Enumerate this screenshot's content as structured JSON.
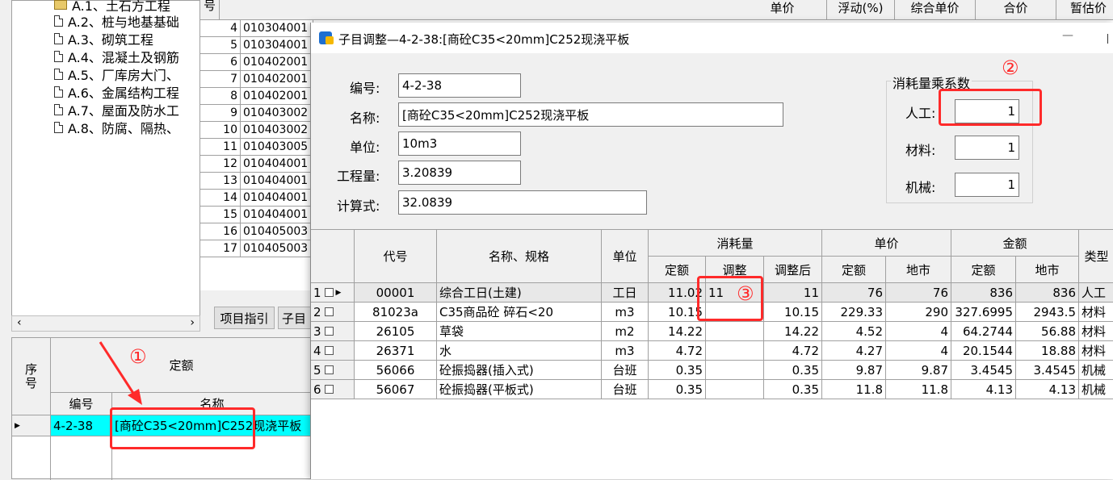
{
  "tree": {
    "items": [
      {
        "label": "A.1、土石方工程",
        "open": true
      },
      {
        "label": "A.2、桩与地基基础"
      },
      {
        "label": "A.3、砌筑工程"
      },
      {
        "label": "A.4、混凝土及钢筋"
      },
      {
        "label": "A.5、厂库房大门、"
      },
      {
        "label": "A.6、金属结构工程"
      },
      {
        "label": "A.7、屋面及防水工"
      },
      {
        "label": "A.8、防腐、隔热、"
      }
    ]
  },
  "bg_table": {
    "hdr_seq": "号",
    "headers": [
      "单价",
      "浮动(%)",
      "综合单价",
      "合价",
      "暂估价"
    ],
    "rows": [
      {
        "seq": "4",
        "code": "010304001"
      },
      {
        "seq": "5",
        "code": "010304001"
      },
      {
        "seq": "6",
        "code": "010402001"
      },
      {
        "seq": "7",
        "code": "010402001"
      },
      {
        "seq": "8",
        "code": "010402001"
      },
      {
        "seq": "9",
        "code": "010403002"
      },
      {
        "seq": "10",
        "code": "010403002"
      },
      {
        "seq": "11",
        "code": "010403005"
      },
      {
        "seq": "12",
        "code": "010404001"
      },
      {
        "seq": "13",
        "code": "010404001"
      },
      {
        "seq": "14",
        "code": "010404001"
      },
      {
        "seq": "15",
        "code": "010404001"
      },
      {
        "seq": "16",
        "code": "010405003"
      },
      {
        "seq": "17",
        "code": "010405003"
      }
    ],
    "tab_guide": "项目指引",
    "tab_sub": "子目"
  },
  "bottom": {
    "hdr_seq": "序号",
    "hdr_quota": "定额",
    "hdr_code": "编号",
    "hdr_name": "名称",
    "row": {
      "code": "4-2-38",
      "name": "[商砼C35<20mm]C252现浇平板"
    }
  },
  "dialog": {
    "title": "子目调整—4-2-38:[商砼C35<20mm]C252现浇平板",
    "minimize": "—",
    "fields": {
      "code_label": "编号:",
      "code_value": "4-2-38",
      "name_label": "名称:",
      "name_value": "[商砼C35<20mm]C252现浇平板",
      "unit_label": "单位:",
      "unit_value": "10m3",
      "qty_label": "工程量:",
      "qty_value": "3.20839",
      "formula_label": "计算式:",
      "formula_value": "32.0839"
    },
    "coef": {
      "title": "消耗量乘系数",
      "labor_label": "人工:",
      "labor_value": "1",
      "material_label": "材料:",
      "material_value": "1",
      "machine_label": "机械:",
      "machine_value": "1"
    },
    "grid": {
      "h_code": "代号",
      "h_name": "名称、规格",
      "h_unit": "单位",
      "h_consumption": "消耗量",
      "h_price": "单价",
      "h_amount": "金额",
      "h_type": "类型",
      "h_quota": "定额",
      "h_adjust": "调整",
      "h_adjusted": "调整后",
      "h_price_quota": "定额",
      "h_price_market": "地市",
      "h_amt_quota": "定额",
      "h_amt_market": "地市",
      "rows": [
        {
          "idx": "1",
          "code": "00001",
          "name": "综合工日(土建)",
          "unit": "工日",
          "quota": "11.02",
          "adjust": "11",
          "adjusted": "11",
          "p_quota": "76",
          "p_market": "76",
          "a_quota": "836",
          "a_market": "836",
          "type": "人工"
        },
        {
          "idx": "2",
          "code": "81023a",
          "name": "C35商品砼 碎石<20",
          "unit": "m3",
          "quota": "10.15",
          "adjust": "",
          "adjusted": "10.15",
          "p_quota": "229.33",
          "p_market": "290",
          "a_quota": "327.6995",
          "a_market": "2943.5",
          "type": "材料"
        },
        {
          "idx": "3",
          "code": "26105",
          "name": "草袋",
          "unit": "m2",
          "quota": "14.22",
          "adjust": "",
          "adjusted": "14.22",
          "p_quota": "4.52",
          "p_market": "4",
          "a_quota": "64.2744",
          "a_market": "56.88",
          "type": "材料"
        },
        {
          "idx": "4",
          "code": "26371",
          "name": "水",
          "unit": "m3",
          "quota": "4.72",
          "adjust": "",
          "adjusted": "4.72",
          "p_quota": "4.27",
          "p_market": "4",
          "a_quota": "20.1544",
          "a_market": "18.88",
          "type": "材料"
        },
        {
          "idx": "5",
          "code": "56066",
          "name": "砼振捣器(插入式)",
          "unit": "台班",
          "quota": "0.35",
          "adjust": "",
          "adjusted": "0.35",
          "p_quota": "9.87",
          "p_market": "9.87",
          "a_quota": "3.4545",
          "a_market": "3.4545",
          "type": "机械"
        },
        {
          "idx": "6",
          "code": "56067",
          "name": "砼振捣器(平板式)",
          "unit": "台班",
          "quota": "0.35",
          "adjust": "",
          "adjusted": "0.35",
          "p_quota": "11.8",
          "p_market": "11.8",
          "a_quota": "4.13",
          "a_market": "4.13",
          "type": "机械"
        }
      ]
    }
  },
  "annotations": {
    "a1": "①",
    "a2": "②",
    "a3": "③"
  },
  "colors": {
    "selected_row": "#00ffff",
    "annotation": "#ff2a2a"
  }
}
